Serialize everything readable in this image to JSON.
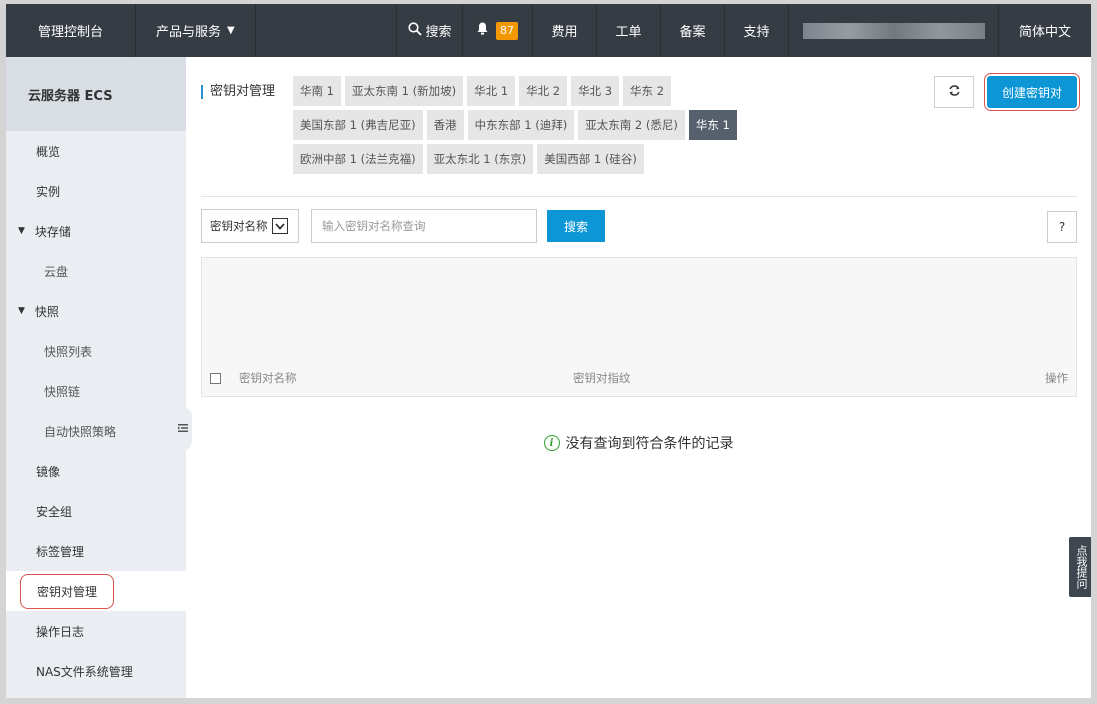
{
  "topbar": {
    "console": "管理控制台",
    "products": "产品与服务",
    "search": "搜索",
    "notification_count": "87",
    "fee": "费用",
    "ticket": "工单",
    "icp": "备案",
    "support": "支持",
    "language": "简体中文"
  },
  "sidebar": {
    "header": "云服务器 ECS",
    "items": [
      {
        "label": "概览"
      },
      {
        "label": "实例"
      },
      {
        "label": "块存储"
      },
      {
        "label": "云盘"
      },
      {
        "label": "快照"
      },
      {
        "label": "快照列表"
      },
      {
        "label": "快照链"
      },
      {
        "label": "自动快照策略"
      },
      {
        "label": "镜像"
      },
      {
        "label": "安全组"
      },
      {
        "label": "标签管理"
      },
      {
        "label": "密钥对管理"
      },
      {
        "label": "操作日志"
      },
      {
        "label": "NAS文件系统管理"
      }
    ]
  },
  "main": {
    "title": "密钥对管理",
    "regions": {
      "row1": [
        "华南 1",
        "亚太东南 1 (新加坡)",
        "华北 1",
        "华北 2",
        "华北 3",
        "华东 2"
      ],
      "row2": [
        "美国东部 1 (弗吉尼亚)",
        "香港",
        "中东东部 1 (迪拜)",
        "亚太东南 2 (悉尼)",
        "华东 1"
      ],
      "row3": [
        "欧洲中部 1 (法兰克福)",
        "亚太东北 1 (东京)",
        "美国西部 1 (硅谷)"
      ],
      "selected": "华东 1"
    },
    "create_button": "创建密钥对",
    "filter": {
      "selected": "密钥对名称",
      "placeholder": "输入密钥对名称查询",
      "search_button": "搜索",
      "help": "?"
    },
    "table": {
      "columns": [
        "密钥对名称",
        "密钥对指纹",
        "操作"
      ]
    },
    "empty_message": "没有查询到符合条件的记录"
  },
  "feedback": "点我提问",
  "colors": {
    "topbar_bg": "#363c44",
    "accent": "#0c96d6",
    "highlight_ring": "#d9534f",
    "selected_region": "#56606d",
    "badge": "#f39800"
  }
}
